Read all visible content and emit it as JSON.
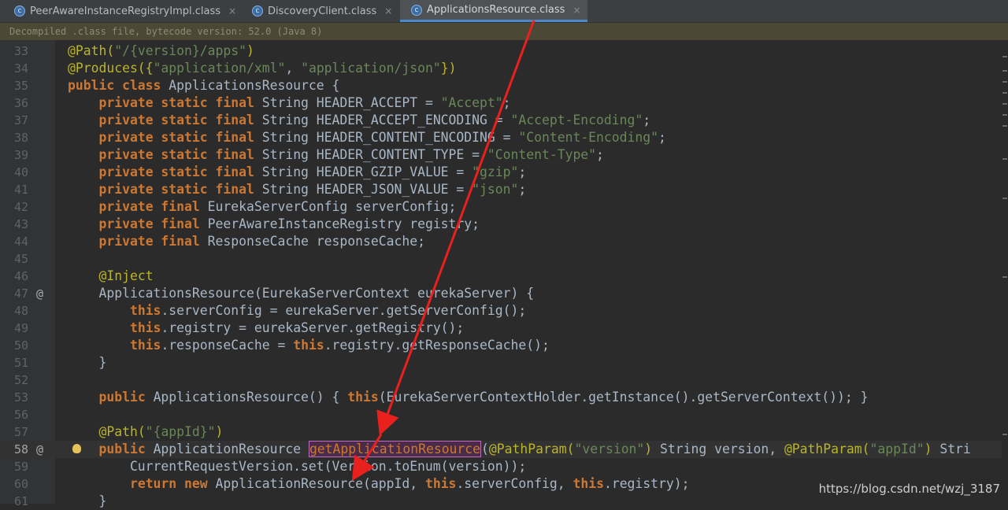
{
  "tabs": [
    {
      "label": "PeerAwareInstanceRegistryImpl.class",
      "close": "×",
      "icon": "class-file-icon"
    },
    {
      "label": "DiscoveryClient.class",
      "close": "×",
      "icon": "class-file-icon"
    },
    {
      "label": "ApplicationsResource.class",
      "close": "×",
      "icon": "class-file-icon"
    }
  ],
  "active_tab": "ApplicationsResource.class",
  "banner": "Decompiled .class file, bytecode version: 52.0 (Java 8)",
  "lines": [
    {
      "n": "33",
      "tokens": [
        [
          "ann",
          "@Path("
        ],
        [
          "str",
          "\"/{version}/apps\""
        ],
        [
          "ann",
          ")"
        ]
      ]
    },
    {
      "n": "34",
      "tokens": [
        [
          "ann",
          "@Produces({"
        ],
        [
          "str",
          "\"application/xml\""
        ],
        [
          "p",
          ", "
        ],
        [
          "str",
          "\"application/json\""
        ],
        [
          "ann",
          "})"
        ]
      ]
    },
    {
      "n": "35",
      "tokens": [
        [
          "kw",
          "public class "
        ],
        [
          "p",
          "ApplicationsResource {"
        ]
      ]
    },
    {
      "n": "36",
      "tokens": [
        [
          "p",
          "    "
        ],
        [
          "kw",
          "private static final "
        ],
        [
          "p",
          "String HEADER_ACCEPT = "
        ],
        [
          "str",
          "\"Accept\""
        ],
        [
          "p",
          ";"
        ]
      ]
    },
    {
      "n": "37",
      "tokens": [
        [
          "p",
          "    "
        ],
        [
          "kw",
          "private static final "
        ],
        [
          "p",
          "String HEADER_ACCEPT_ENCODING = "
        ],
        [
          "str",
          "\"Accept-Encoding\""
        ],
        [
          "p",
          ";"
        ]
      ]
    },
    {
      "n": "38",
      "tokens": [
        [
          "p",
          "    "
        ],
        [
          "kw",
          "private static final "
        ],
        [
          "p",
          "String HEADER_CONTENT_ENCODING = "
        ],
        [
          "str",
          "\"Content-Encoding\""
        ],
        [
          "p",
          ";"
        ]
      ]
    },
    {
      "n": "39",
      "tokens": [
        [
          "p",
          "    "
        ],
        [
          "kw",
          "private static final "
        ],
        [
          "p",
          "String HEADER_CONTENT_TYPE = "
        ],
        [
          "str",
          "\"Content-Type\""
        ],
        [
          "p",
          ";"
        ]
      ]
    },
    {
      "n": "40",
      "tokens": [
        [
          "p",
          "    "
        ],
        [
          "kw",
          "private static final "
        ],
        [
          "p",
          "String HEADER_GZIP_VALUE = "
        ],
        [
          "str",
          "\"gzip\""
        ],
        [
          "p",
          ";"
        ]
      ]
    },
    {
      "n": "41",
      "tokens": [
        [
          "p",
          "    "
        ],
        [
          "kw",
          "private static final "
        ],
        [
          "p",
          "String HEADER_JSON_VALUE = "
        ],
        [
          "str",
          "\"json\""
        ],
        [
          "p",
          ";"
        ]
      ]
    },
    {
      "n": "42",
      "tokens": [
        [
          "p",
          "    "
        ],
        [
          "kw",
          "private final "
        ],
        [
          "p",
          "EurekaServerConfig serverConfig;"
        ]
      ]
    },
    {
      "n": "43",
      "tokens": [
        [
          "p",
          "    "
        ],
        [
          "kw",
          "private final "
        ],
        [
          "p",
          "PeerAwareInstanceRegistry registry;"
        ]
      ]
    },
    {
      "n": "44",
      "tokens": [
        [
          "p",
          "    "
        ],
        [
          "kw",
          "private final "
        ],
        [
          "p",
          "ResponseCache responseCache;"
        ]
      ]
    },
    {
      "n": "45",
      "tokens": []
    },
    {
      "n": "46",
      "tokens": [
        [
          "p",
          "    "
        ],
        [
          "ann",
          "@Inject"
        ]
      ]
    },
    {
      "n": "47",
      "gutter": "@",
      "tokens": [
        [
          "p",
          "    ApplicationsResource(EurekaServerContext eurekaServer) {"
        ]
      ]
    },
    {
      "n": "48",
      "tokens": [
        [
          "p",
          "        "
        ],
        [
          "kw",
          "this"
        ],
        [
          "p",
          ".serverConfig = eurekaServer.getServerConfig();"
        ]
      ]
    },
    {
      "n": "49",
      "tokens": [
        [
          "p",
          "        "
        ],
        [
          "kw",
          "this"
        ],
        [
          "p",
          ".registry = eurekaServer.getRegistry();"
        ]
      ]
    },
    {
      "n": "50",
      "tokens": [
        [
          "p",
          "        "
        ],
        [
          "kw",
          "this"
        ],
        [
          "p",
          ".responseCache = "
        ],
        [
          "kw",
          "this"
        ],
        [
          "p",
          ".registry.getResponseCache();"
        ]
      ]
    },
    {
      "n": "51",
      "tokens": [
        [
          "p",
          "    }"
        ]
      ]
    },
    {
      "n": "52",
      "tokens": []
    },
    {
      "n": "53",
      "tokens": [
        [
          "p",
          "    "
        ],
        [
          "kw",
          "public "
        ],
        [
          "p",
          "ApplicationsResource() { "
        ],
        [
          "kw",
          "this"
        ],
        [
          "p",
          "(EurekaServerContextHolder.getInstance().getServerContext()); }"
        ]
      ]
    },
    {
      "n": "56",
      "tokens": []
    },
    {
      "n": "57",
      "tokens": [
        [
          "p",
          "    "
        ],
        [
          "ann",
          "@Path("
        ],
        [
          "str",
          "\"{appId}\""
        ],
        [
          "ann",
          ")"
        ]
      ]
    },
    {
      "n": "58",
      "gutter": "@",
      "bulb": true,
      "current": true,
      "tokens": [
        [
          "p",
          "    "
        ],
        [
          "kw",
          "public "
        ],
        [
          "p",
          "ApplicationResource "
        ],
        [
          "hl",
          "getApplicationResource"
        ],
        [
          "p",
          "("
        ],
        [
          "ann",
          "@PathParam("
        ],
        [
          "str",
          "\"version\""
        ],
        [
          "ann",
          ")"
        ],
        [
          "p",
          " String version, "
        ],
        [
          "ann",
          "@PathParam("
        ],
        [
          "str",
          "\"appId\""
        ],
        [
          "ann",
          ")"
        ],
        [
          "p",
          " Stri"
        ]
      ]
    },
    {
      "n": "59",
      "tokens": [
        [
          "p",
          "        CurrentRequestVersion.set(Version.toEnum(version));"
        ]
      ]
    },
    {
      "n": "60",
      "tokens": [
        [
          "p",
          "        "
        ],
        [
          "kw",
          "return new "
        ],
        [
          "p",
          "ApplicationResource(appId, "
        ],
        [
          "kw",
          "this"
        ],
        [
          "p",
          ".serverConfig, "
        ],
        [
          "kw",
          "this"
        ],
        [
          "p",
          ".registry);"
        ]
      ]
    },
    {
      "n": "61",
      "tokens": [
        [
          "p",
          "    }"
        ]
      ]
    }
  ],
  "watermark": "https://blog.csdn.net/wzj_3187",
  "colors": {
    "keyword": "#cc7832",
    "string": "#6a8759",
    "annotation": "#bbb529",
    "text": "#a9b7c6",
    "arrow": "#e8211e"
  }
}
